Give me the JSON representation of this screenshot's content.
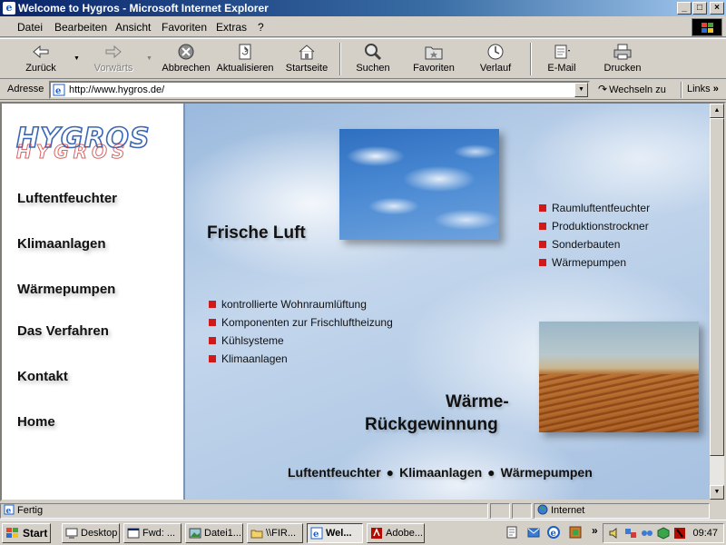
{
  "window": {
    "title": "Welcome to Hygros - Microsoft Internet Explorer",
    "app_icon": "e"
  },
  "menu": [
    {
      "label": "Datei"
    },
    {
      "label": "Bearbeiten"
    },
    {
      "label": "Ansicht"
    },
    {
      "label": "Favoriten"
    },
    {
      "label": "Extras"
    },
    {
      "label": "?"
    }
  ],
  "toolbar": {
    "back": "Zurück",
    "forward": "Vorwärts",
    "stop": "Abbrechen",
    "refresh": "Aktualisieren",
    "home": "Startseite",
    "search": "Suchen",
    "favorites": "Favoriten",
    "history": "Verlauf",
    "mail": "E-Mail",
    "print": "Drucken"
  },
  "address": {
    "label": "Adresse",
    "url": "http://www.hygros.de/",
    "go": "Wechseln zu",
    "links": "Links"
  },
  "site": {
    "logo_text": "HYGROS",
    "nav": [
      "Luftentfeuchter",
      "Klimaanlagen",
      "Wärmepumpen",
      "Das Verfahren",
      "Kontakt",
      "Home"
    ],
    "heading_fresh": "Frische Luft",
    "heading_heat_1": "Wärme-",
    "heading_heat_2": "Rückgewinnung",
    "right_bullets": [
      "Raumluftentfeuchter",
      "Produktionstrockner",
      "Sonderbauten",
      "Wärmepumpen"
    ],
    "left_bullets": [
      "kontrollierte Wohnraumlüftung",
      "Komponenten zur Frischluftheizung",
      "Kühlsysteme",
      "Klimaanlagen"
    ],
    "footer_links": [
      "Luftentfeuchter",
      "Klimaanlagen",
      "Wärmepumpen"
    ],
    "footer_separator": "●"
  },
  "status": {
    "text": "Fertig",
    "zone": "Internet"
  },
  "taskbar": {
    "start": "Start",
    "tasks": [
      "Desktop",
      "Fwd: ...",
      "Datei1...",
      "\\\\FIR...",
      "Wel...",
      "Adobe..."
    ],
    "clock": "09:47"
  },
  "colors": {
    "bullet": "#d21919",
    "titlebar": "#0a246a",
    "sky": "#9ab9dd"
  }
}
